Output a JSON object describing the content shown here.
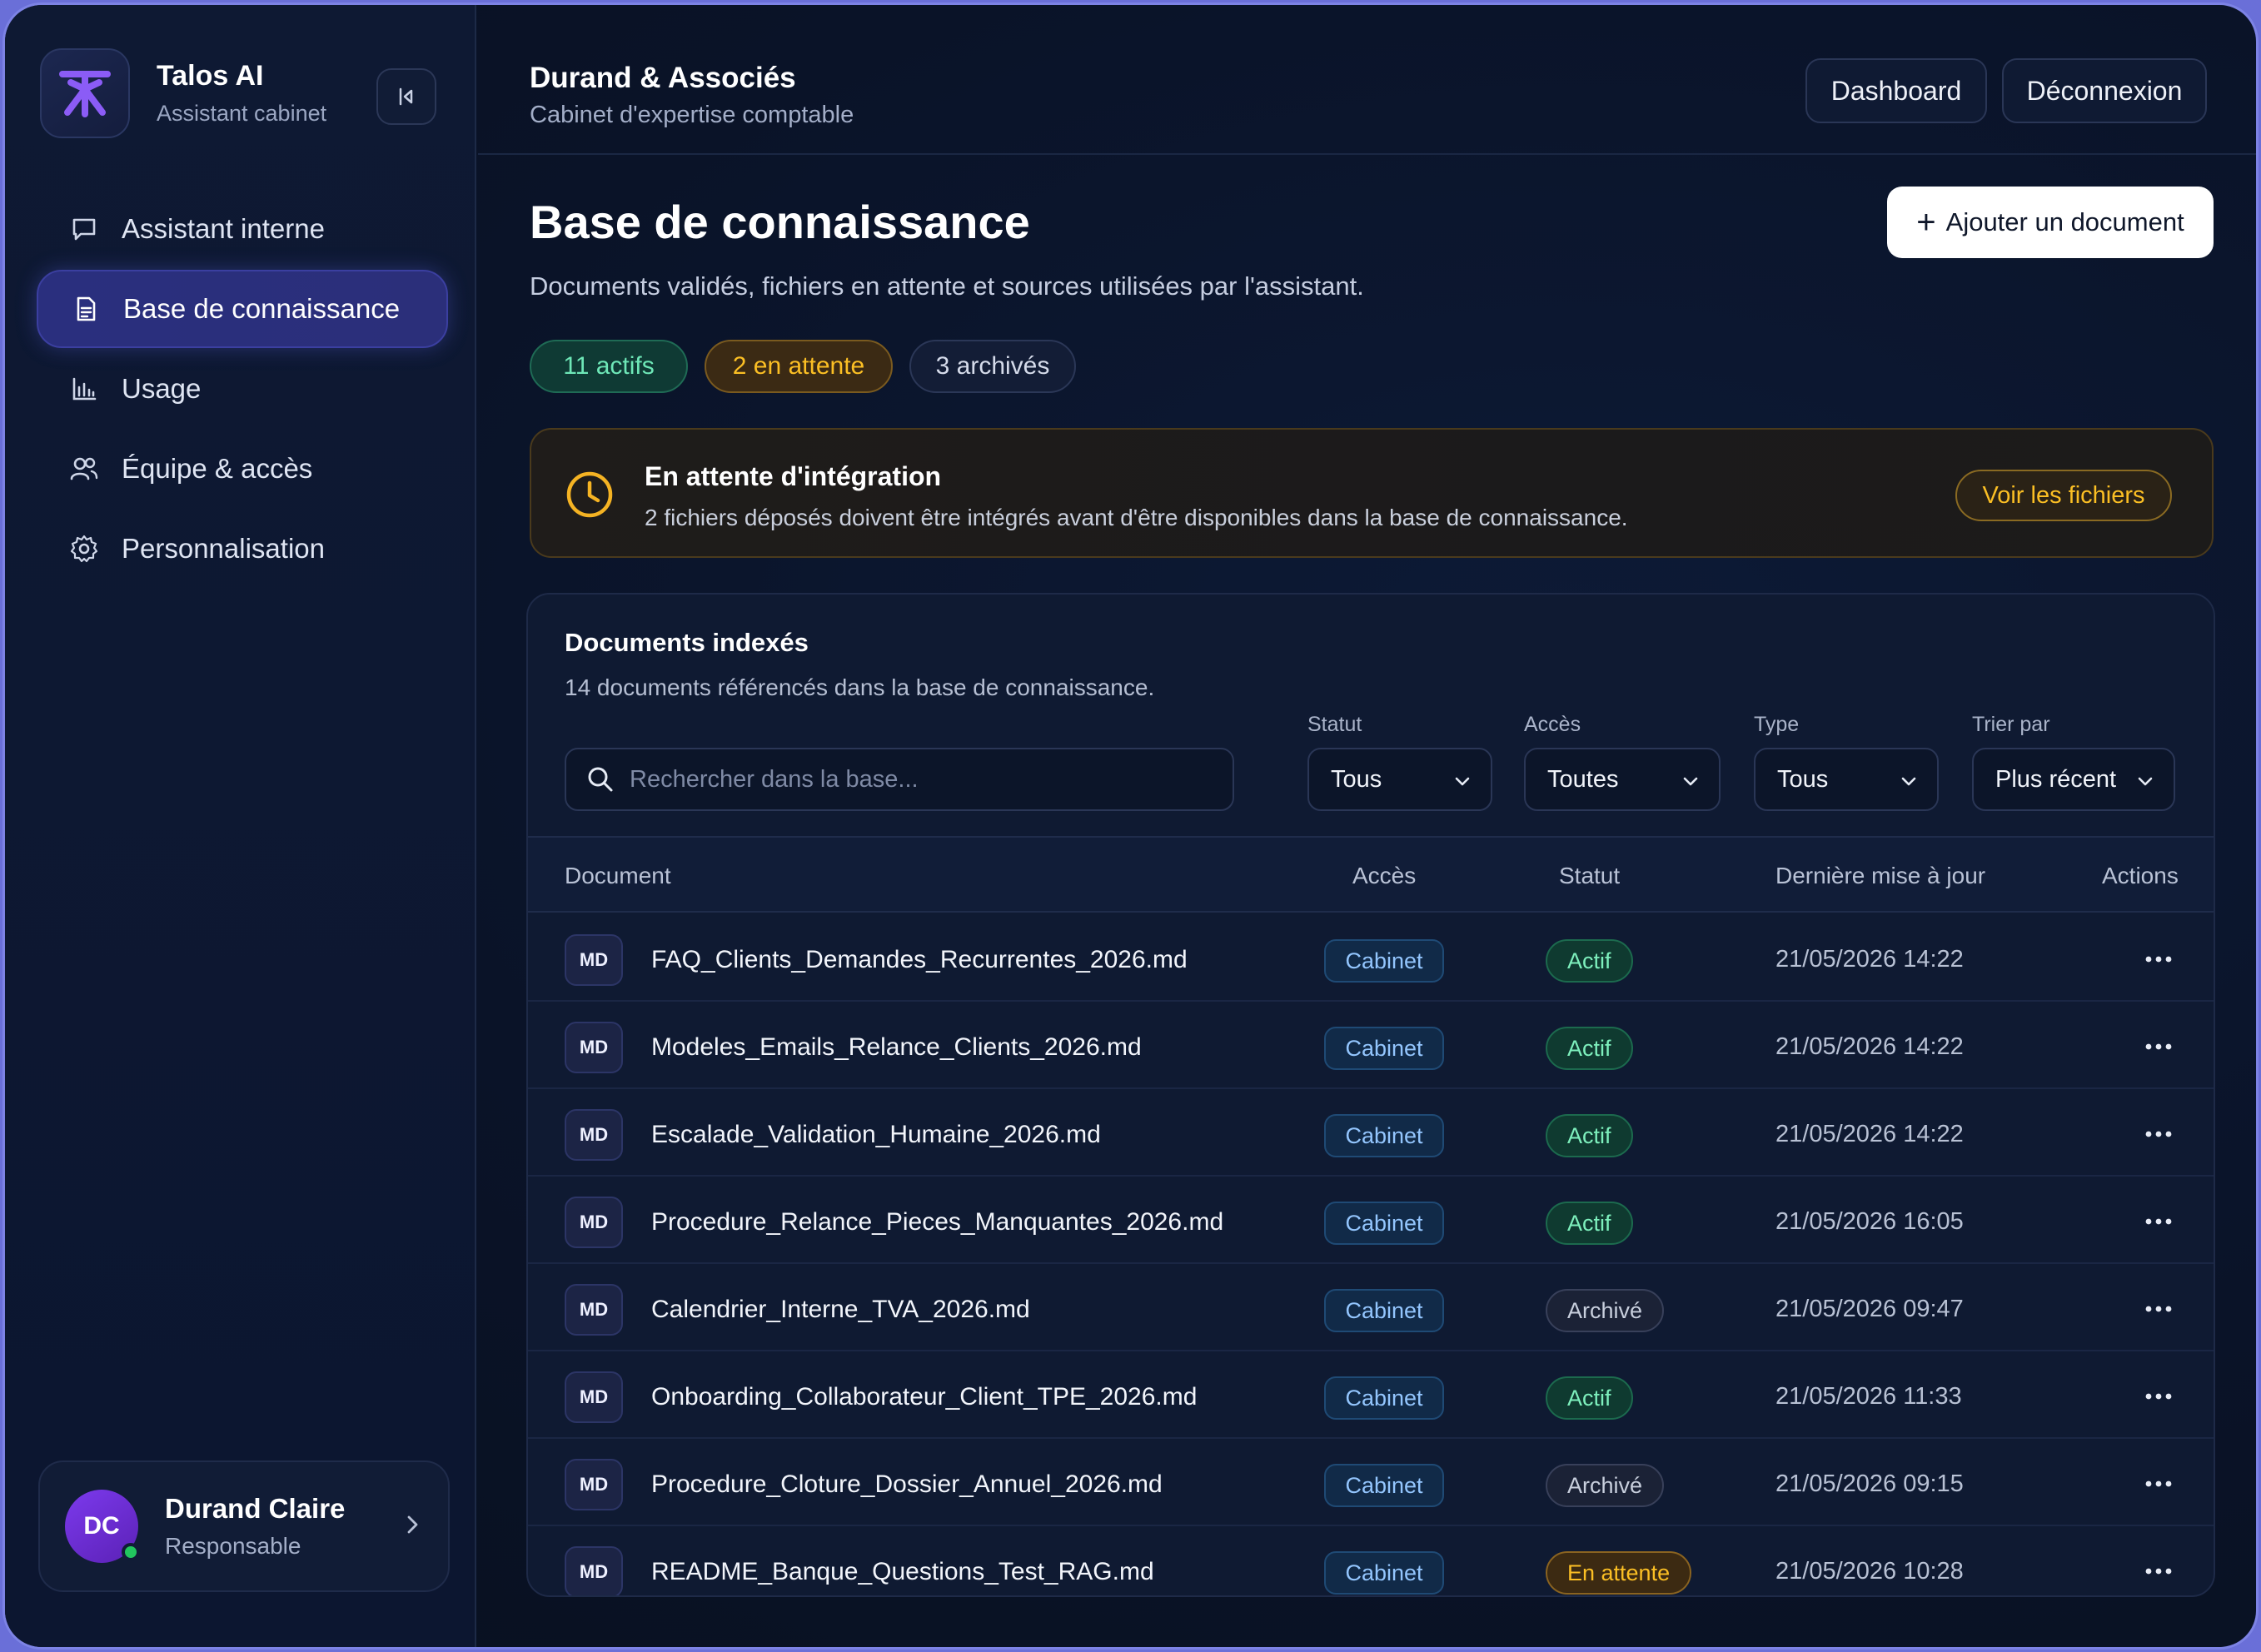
{
  "brand": {
    "name": "Talos AI",
    "subtitle": "Assistant cabinet"
  },
  "sidebar": {
    "items": [
      {
        "label": "Assistant interne",
        "icon": "chat-icon",
        "active": false
      },
      {
        "label": "Base de connaissance",
        "icon": "document-icon",
        "active": true
      },
      {
        "label": "Usage",
        "icon": "bar-chart-icon",
        "active": false
      },
      {
        "label": "Équipe & accès",
        "icon": "users-icon",
        "active": false
      },
      {
        "label": "Personnalisation",
        "icon": "gear-icon",
        "active": false
      }
    ]
  },
  "user": {
    "initials": "DC",
    "name": "Durand Claire",
    "role": "Responsable"
  },
  "header": {
    "firm_name": "Durand & Associés",
    "firm_subtitle": "Cabinet d'expertise comptable",
    "dashboard_label": "Dashboard",
    "logout_label": "Déconnexion"
  },
  "page": {
    "title": "Base de connaissance",
    "description": "Documents validés, fichiers en attente et sources utilisées par l'assistant.",
    "add_label": "Ajouter un document",
    "pills": {
      "active": "11 actifs",
      "pending": "2 en attente",
      "archived": "3 archivés"
    }
  },
  "banner": {
    "title": "En attente d'intégration",
    "text": "2 fichiers déposés doivent être intégrés avant d'être disponibles dans la base de connaissance.",
    "button": "Voir les fichiers"
  },
  "documents": {
    "title": "Documents indexés",
    "subtitle": "14 documents référencés dans la base de connaissance.",
    "search_placeholder": "Rechercher dans la base...",
    "filters": {
      "status": {
        "label": "Statut",
        "value": "Tous"
      },
      "access": {
        "label": "Accès",
        "value": "Toutes"
      },
      "type": {
        "label": "Type",
        "value": "Tous"
      },
      "sort": {
        "label": "Trier par",
        "value": "Plus récent"
      }
    },
    "columns": {
      "document": "Document",
      "access": "Accès",
      "status": "Statut",
      "updated": "Dernière mise à jour",
      "actions": "Actions"
    },
    "rows": [
      {
        "type": "MD",
        "name": "FAQ_Clients_Demandes_Recurrentes_2026.md",
        "access": "Cabinet",
        "status": "Actif",
        "updated": "21/05/2026 14:22"
      },
      {
        "type": "MD",
        "name": "Modeles_Emails_Relance_Clients_2026.md",
        "access": "Cabinet",
        "status": "Actif",
        "updated": "21/05/2026 14:22"
      },
      {
        "type": "MD",
        "name": "Escalade_Validation_Humaine_2026.md",
        "access": "Cabinet",
        "status": "Actif",
        "updated": "21/05/2026 14:22"
      },
      {
        "type": "MD",
        "name": "Procedure_Relance_Pieces_Manquantes_2026.md",
        "access": "Cabinet",
        "status": "Actif",
        "updated": "21/05/2026 16:05"
      },
      {
        "type": "MD",
        "name": "Calendrier_Interne_TVA_2026.md",
        "access": "Cabinet",
        "status": "Archivé",
        "updated": "21/05/2026 09:47"
      },
      {
        "type": "MD",
        "name": "Onboarding_Collaborateur_Client_TPE_2026.md",
        "access": "Cabinet",
        "status": "Actif",
        "updated": "21/05/2026 11:33"
      },
      {
        "type": "MD",
        "name": "Procedure_Cloture_Dossier_Annuel_2026.md",
        "access": "Cabinet",
        "status": "Archivé",
        "updated": "21/05/2026 09:15"
      },
      {
        "type": "MD",
        "name": "README_Banque_Questions_Test_RAG.md",
        "access": "Cabinet",
        "status": "En attente",
        "updated": "21/05/2026 10:28"
      }
    ]
  },
  "colors": {
    "accent": "#7c3aed",
    "active_green": "#7ef0bd",
    "pending_amber": "#fbbf24",
    "access_blue": "#93c5fd"
  }
}
